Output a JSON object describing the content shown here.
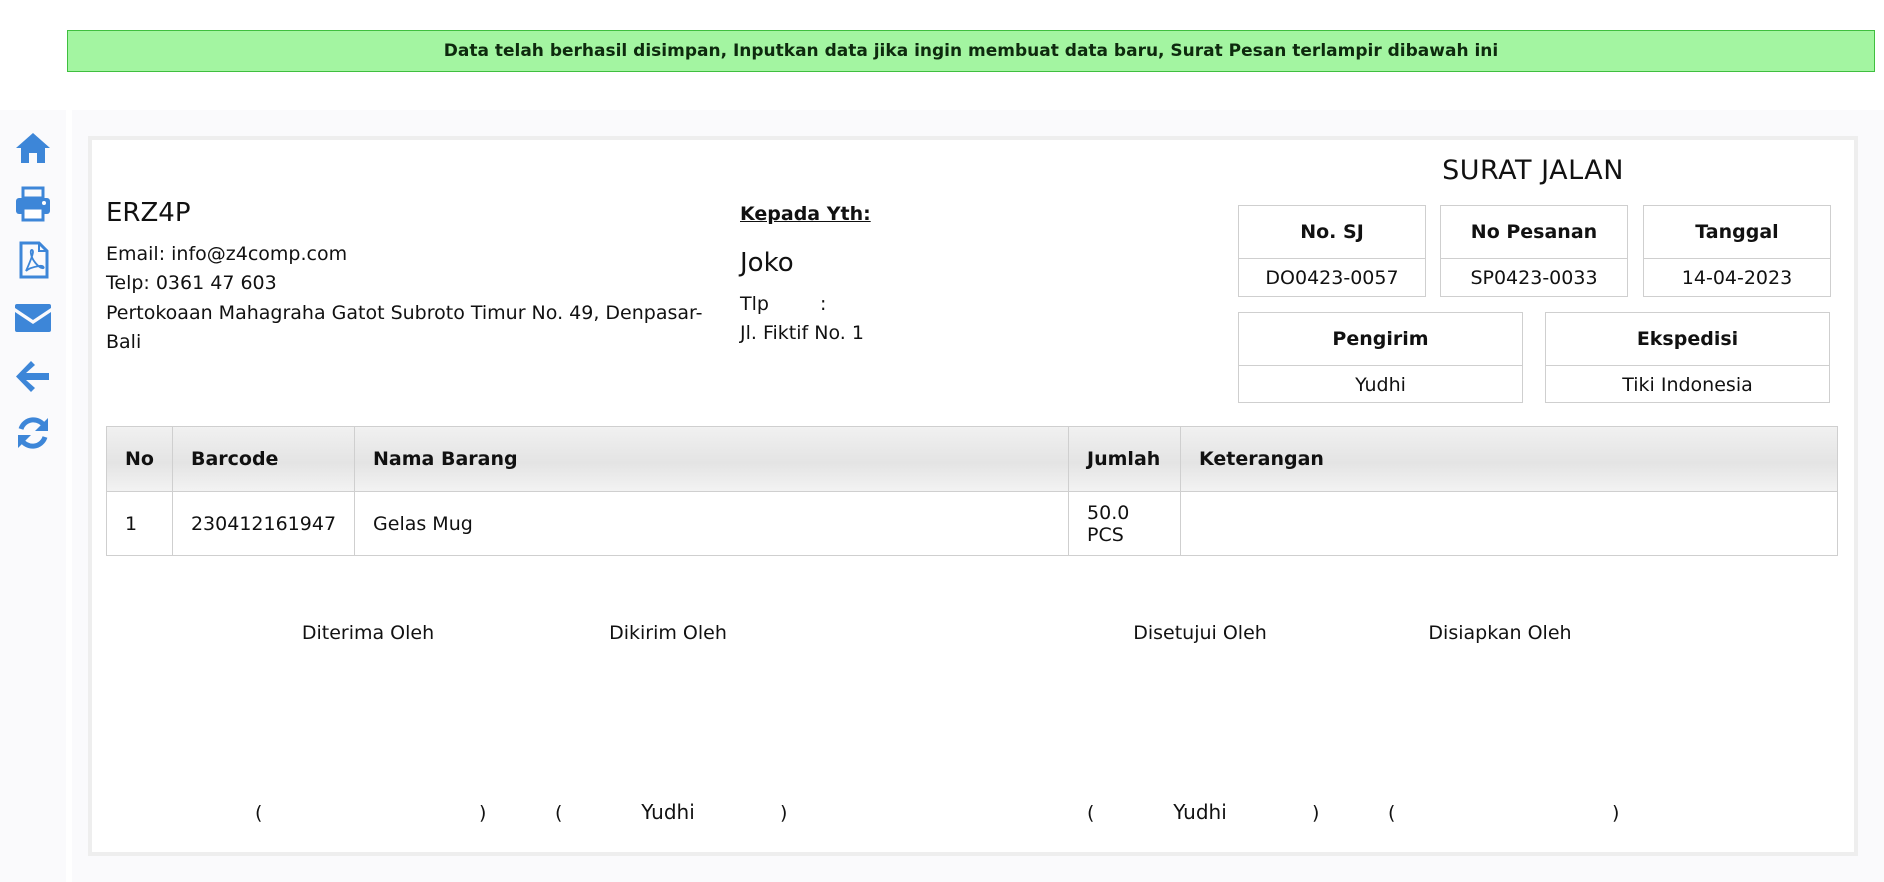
{
  "alert": {
    "message": "Data telah berhasil disimpan, Inputkan data jika ingin membuat data baru, Surat Pesan terlampir dibawah ini",
    "color": "#a3f5a1"
  },
  "sidebar": {
    "icon_color": "#3d86d8",
    "icons": [
      "home-icon",
      "print-icon",
      "pdf-icon",
      "email-icon",
      "back-arrow-icon",
      "refresh-icon"
    ]
  },
  "company": {
    "name": "ERZ4P",
    "email": "Email: info@z4comp.com",
    "phone": "Telp: 0361 47 603",
    "address_line1": "Pertokoaan Mahagraha Gatot Subroto Timur No. 49, Denpasar-",
    "address_line2": "Bali"
  },
  "recipient": {
    "label": "Kepada Yth:",
    "name": "Joko",
    "phone_label": "Tlp",
    "phone_sep": ":",
    "address": "Jl. Fiktif No. 1"
  },
  "document": {
    "title": "SURAT JALAN",
    "no_sj_label": "No. SJ",
    "no_sj": "DO0423-0057",
    "no_pesanan_label": "No Pesanan",
    "no_pesanan": "SP0423-0033",
    "tanggal_label": "Tanggal",
    "tanggal": "14-04-2023",
    "pengirim_label": "Pengirim",
    "pengirim": "Yudhi",
    "ekspedisi_label": "Ekspedisi",
    "ekspedisi": "Tiki Indonesia"
  },
  "table": {
    "headers": [
      "No",
      "Barcode",
      "Nama Barang",
      "Jumlah",
      "Keterangan"
    ],
    "rows": [
      [
        "1",
        "230412161947",
        "Gelas Mug",
        "50.0 PCS",
        ""
      ]
    ]
  },
  "signatures": [
    {
      "title": "Diterima Oleh",
      "name": ""
    },
    {
      "title": "Dikirim Oleh",
      "name": "Yudhi"
    },
    {
      "title": "Disetujui Oleh",
      "name": "Yudhi"
    },
    {
      "title": "Disiapkan Oleh",
      "name": ""
    }
  ],
  "paren_open": "(",
  "paren_close": ")"
}
